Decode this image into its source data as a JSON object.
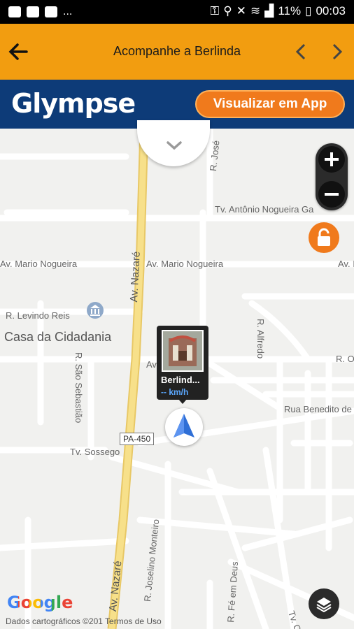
{
  "status_bar": {
    "battery": "11%",
    "time": "00:03",
    "ellipsis": "..."
  },
  "app_bar": {
    "title": "Acompanhe a Berlinda"
  },
  "banner": {
    "logo_text": "Glympse",
    "cta_label": "Visualizar em App"
  },
  "map": {
    "streets": {
      "av_nazare_1": "Av. Nazaré",
      "av_nazare_2": "Av. Nazaré",
      "av_mario_nogueira_1": "Av. Mario Nogueira",
      "av_mario_nogueira_2": "Av. Mario Nogueira",
      "av_mario_nogueira_3": "Av. I",
      "tv_antonio": "Tv. Antônio Nogueira Ga",
      "r_levindo_reis": "R. Levindo Reis",
      "r_alfredo": "R. Alfredo",
      "r_sao_sebastiao": "R. São Sebastião",
      "tv_sossego": "Tv. Sossego",
      "rua_benedito": "Rua Benedito de",
      "r_joselino": "R. Joselino Monteiro",
      "r_fe_em_deus": "R. Fé em Deus",
      "r_jose": "R. José",
      "r_o": "R. O",
      "av_short": "Av",
      "tv_c": "Tv. C"
    },
    "poi_name": "Casa da Cidadania",
    "route_shield": "PA-450",
    "google_logo": "Google",
    "attribution": "Dados cartográficos ©201  Termos de Uso",
    "popup": {
      "name": "Berlind...",
      "speed": "-- km/h"
    }
  },
  "colors": {
    "app_bar": "#f29d10",
    "banner": "#0d3b78",
    "cta": "#f07a1c",
    "road_major": "#f7e08a"
  }
}
